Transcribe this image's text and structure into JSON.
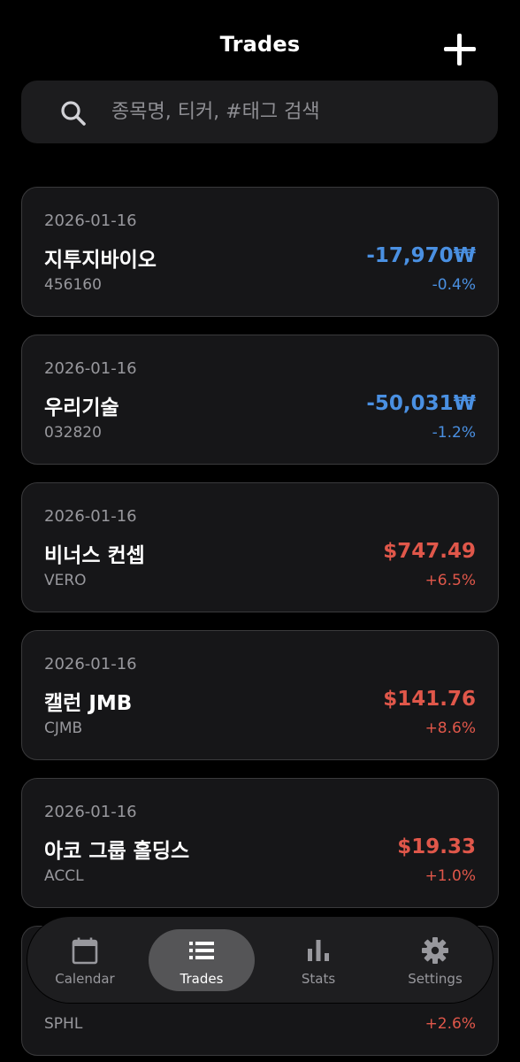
{
  "header": {
    "title": "Trades",
    "add_icon": "plus-icon"
  },
  "search": {
    "icon": "search-icon",
    "placeholder": "종목명, 티커, #태그 검색",
    "value": ""
  },
  "colors": {
    "background": "#000000",
    "card": "#161618",
    "loss": "#4a90e2",
    "gain": "#e0574a",
    "muted": "#98989d"
  },
  "trades": [
    {
      "date": "2026-01-16",
      "name": "지투지바이오",
      "ticker": "456160",
      "amount": "-17,970₩",
      "pct": "-0.4%",
      "direction": "loss"
    },
    {
      "date": "2026-01-16",
      "name": "우리기술",
      "ticker": "032820",
      "amount": "-50,031₩",
      "pct": "-1.2%",
      "direction": "loss"
    },
    {
      "date": "2026-01-16",
      "name": "비너스 컨셉",
      "ticker": "VERO",
      "amount": "$747.49",
      "pct": "+6.5%",
      "direction": "gain"
    },
    {
      "date": "2026-01-16",
      "name": "캘런 JMB",
      "ticker": "CJMB",
      "amount": "$141.76",
      "pct": "+8.6%",
      "direction": "gain"
    },
    {
      "date": "2026-01-16",
      "name": "아코 그룹 홀딩스",
      "ticker": "ACCL",
      "amount": "$19.33",
      "pct": "+1.0%",
      "direction": "gain"
    },
    {
      "date": "",
      "name": "",
      "ticker": "SPHL",
      "amount": "",
      "pct": "+2.6%",
      "direction": "gain"
    }
  ],
  "tabs": [
    {
      "label": "Calendar",
      "icon": "calendar-icon",
      "active": false
    },
    {
      "label": "Trades",
      "icon": "list-icon",
      "active": true
    },
    {
      "label": "Stats",
      "icon": "bar-chart-icon",
      "active": false
    },
    {
      "label": "Settings",
      "icon": "gear-icon",
      "active": false
    }
  ]
}
